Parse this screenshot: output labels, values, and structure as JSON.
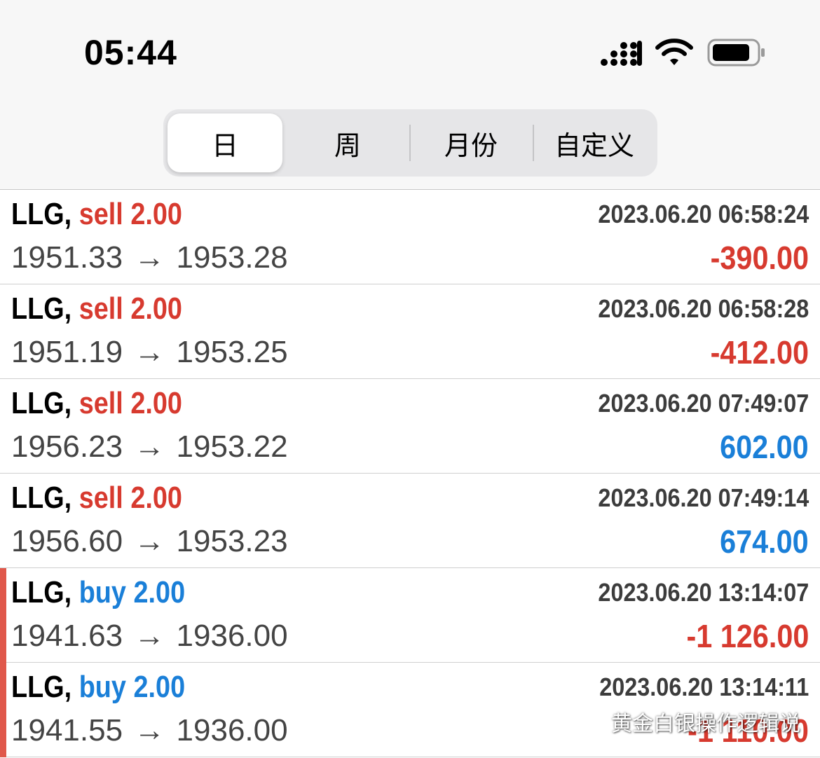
{
  "status_bar": {
    "time": "05:44",
    "icons": [
      "signal-icon",
      "wifi-icon",
      "battery-icon"
    ]
  },
  "tabs": [
    {
      "label": "日",
      "active": true
    },
    {
      "label": "周",
      "active": false
    },
    {
      "label": "月份",
      "active": false
    },
    {
      "label": "自定义",
      "active": false
    }
  ],
  "trades": [
    {
      "symbol": "LLG,",
      "side": "sell 2.00",
      "side_type": "sell",
      "datetime": "2023.06.20 06:58:24",
      "open": "1951.33",
      "arrow": "→",
      "close": "1953.28",
      "profit": "-390.00",
      "profit_sign": "neg",
      "flag": false
    },
    {
      "symbol": "LLG,",
      "side": "sell 2.00",
      "side_type": "sell",
      "datetime": "2023.06.20 06:58:28",
      "open": "1951.19",
      "arrow": "→",
      "close": "1953.25",
      "profit": "-412.00",
      "profit_sign": "neg",
      "flag": false
    },
    {
      "symbol": "LLG,",
      "side": "sell 2.00",
      "side_type": "sell",
      "datetime": "2023.06.20 07:49:07",
      "open": "1956.23",
      "arrow": "→",
      "close": "1953.22",
      "profit": "602.00",
      "profit_sign": "pos",
      "flag": false
    },
    {
      "symbol": "LLG,",
      "side": "sell 2.00",
      "side_type": "sell",
      "datetime": "2023.06.20 07:49:14",
      "open": "1956.60",
      "arrow": "→",
      "close": "1953.23",
      "profit": "674.00",
      "profit_sign": "pos",
      "flag": false
    },
    {
      "symbol": "LLG,",
      "side": "buy 2.00",
      "side_type": "buy",
      "datetime": "2023.06.20 13:14:07",
      "open": "1941.63",
      "arrow": "→",
      "close": "1936.00",
      "profit": "-1 126.00",
      "profit_sign": "neg",
      "flag": true
    },
    {
      "symbol": "LLG,",
      "side": "buy 2.00",
      "side_type": "buy",
      "datetime": "2023.06.20 13:14:11",
      "open": "1941.55",
      "arrow": "→",
      "close": "1936.00",
      "profit": "-1 110.00",
      "profit_sign": "neg",
      "flag": true
    }
  ],
  "watermark": {
    "text": "黄金白银操作逻辑说",
    "icon": "wechat-icon"
  },
  "colors": {
    "sell": "#d73a2f",
    "buy": "#1a7fd8",
    "flag": "#e0584b"
  }
}
